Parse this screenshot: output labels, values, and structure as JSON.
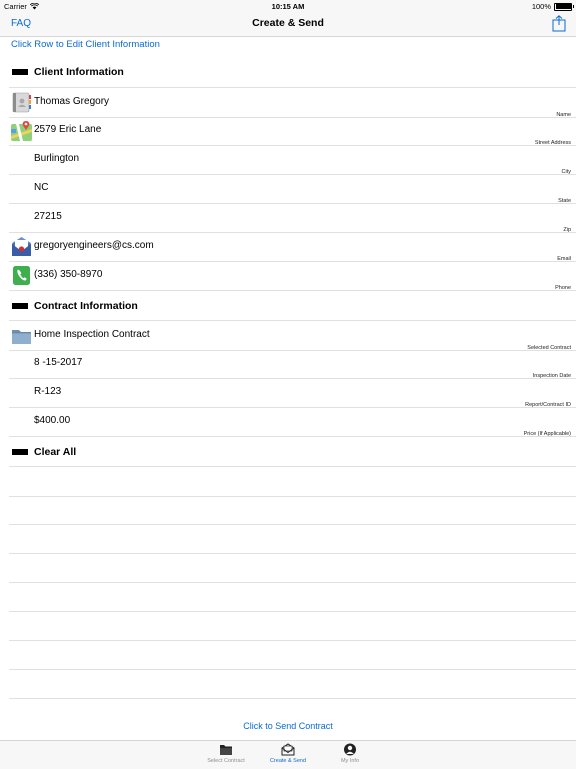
{
  "status_bar": {
    "carrier": "Carrier",
    "time": "10:15 AM",
    "battery": "100%"
  },
  "nav": {
    "left": "FAQ",
    "title": "Create & Send"
  },
  "hint": "Click Row to Edit Client Information",
  "client_section": {
    "title": "Client Information"
  },
  "client_rows": [
    {
      "value": "Thomas Gregory",
      "caption": "Name",
      "icon": "contacts-icon"
    },
    {
      "value": "2579 Eric Lane",
      "caption": "Street Address",
      "icon": "maps-icon"
    },
    {
      "value": "Burlington",
      "caption": "City"
    },
    {
      "value": "NC",
      "caption": "State"
    },
    {
      "value": "27215",
      "caption": "Zip"
    },
    {
      "value": "gregoryengineers@cs.com",
      "caption": "Email",
      "icon": "mail-icon"
    },
    {
      "value": "(336) 350-8970",
      "caption": "Phone",
      "icon": "phone-icon"
    }
  ],
  "contract_section": {
    "title": "Contract Information"
  },
  "contract_rows": [
    {
      "value": "Home Inspection Contract",
      "caption": "Selected Contract",
      "icon": "folder-icon"
    },
    {
      "value": "8 -15-2017",
      "caption": "Inspection Date"
    },
    {
      "value": "R-123",
      "caption": "Report/Contract ID"
    },
    {
      "value": "$400.00",
      "caption": "Price (If Applicable)"
    }
  ],
  "clear_all": "Clear All",
  "send_link": "Click to Send Contract",
  "tabs": [
    {
      "label": "Select Contract",
      "icon": "folder-icon",
      "active": false
    },
    {
      "label": "Create & Send",
      "icon": "envelope-icon",
      "active": true
    },
    {
      "label": "My Info",
      "icon": "person-icon",
      "active": false
    }
  ],
  "colors": {
    "accent": "#0a6ad6",
    "bar_bg": "#f7f7f7",
    "separator": "#e0e0e0"
  }
}
